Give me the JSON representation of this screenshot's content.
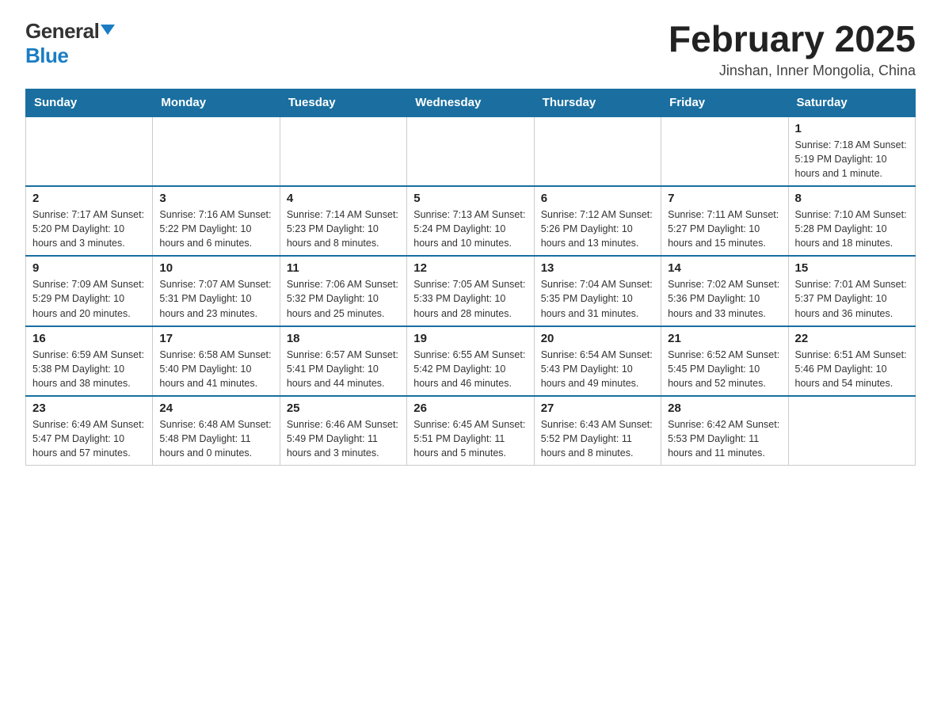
{
  "header": {
    "logo_general": "General",
    "logo_blue": "Blue",
    "month_title": "February 2025",
    "location": "Jinshan, Inner Mongolia, China"
  },
  "days_of_week": [
    "Sunday",
    "Monday",
    "Tuesday",
    "Wednesday",
    "Thursday",
    "Friday",
    "Saturday"
  ],
  "weeks": [
    [
      {
        "day": "",
        "info": ""
      },
      {
        "day": "",
        "info": ""
      },
      {
        "day": "",
        "info": ""
      },
      {
        "day": "",
        "info": ""
      },
      {
        "day": "",
        "info": ""
      },
      {
        "day": "",
        "info": ""
      },
      {
        "day": "1",
        "info": "Sunrise: 7:18 AM\nSunset: 5:19 PM\nDaylight: 10 hours and 1 minute."
      }
    ],
    [
      {
        "day": "2",
        "info": "Sunrise: 7:17 AM\nSunset: 5:20 PM\nDaylight: 10 hours and 3 minutes."
      },
      {
        "day": "3",
        "info": "Sunrise: 7:16 AM\nSunset: 5:22 PM\nDaylight: 10 hours and 6 minutes."
      },
      {
        "day": "4",
        "info": "Sunrise: 7:14 AM\nSunset: 5:23 PM\nDaylight: 10 hours and 8 minutes."
      },
      {
        "day": "5",
        "info": "Sunrise: 7:13 AM\nSunset: 5:24 PM\nDaylight: 10 hours and 10 minutes."
      },
      {
        "day": "6",
        "info": "Sunrise: 7:12 AM\nSunset: 5:26 PM\nDaylight: 10 hours and 13 minutes."
      },
      {
        "day": "7",
        "info": "Sunrise: 7:11 AM\nSunset: 5:27 PM\nDaylight: 10 hours and 15 minutes."
      },
      {
        "day": "8",
        "info": "Sunrise: 7:10 AM\nSunset: 5:28 PM\nDaylight: 10 hours and 18 minutes."
      }
    ],
    [
      {
        "day": "9",
        "info": "Sunrise: 7:09 AM\nSunset: 5:29 PM\nDaylight: 10 hours and 20 minutes."
      },
      {
        "day": "10",
        "info": "Sunrise: 7:07 AM\nSunset: 5:31 PM\nDaylight: 10 hours and 23 minutes."
      },
      {
        "day": "11",
        "info": "Sunrise: 7:06 AM\nSunset: 5:32 PM\nDaylight: 10 hours and 25 minutes."
      },
      {
        "day": "12",
        "info": "Sunrise: 7:05 AM\nSunset: 5:33 PM\nDaylight: 10 hours and 28 minutes."
      },
      {
        "day": "13",
        "info": "Sunrise: 7:04 AM\nSunset: 5:35 PM\nDaylight: 10 hours and 31 minutes."
      },
      {
        "day": "14",
        "info": "Sunrise: 7:02 AM\nSunset: 5:36 PM\nDaylight: 10 hours and 33 minutes."
      },
      {
        "day": "15",
        "info": "Sunrise: 7:01 AM\nSunset: 5:37 PM\nDaylight: 10 hours and 36 minutes."
      }
    ],
    [
      {
        "day": "16",
        "info": "Sunrise: 6:59 AM\nSunset: 5:38 PM\nDaylight: 10 hours and 38 minutes."
      },
      {
        "day": "17",
        "info": "Sunrise: 6:58 AM\nSunset: 5:40 PM\nDaylight: 10 hours and 41 minutes."
      },
      {
        "day": "18",
        "info": "Sunrise: 6:57 AM\nSunset: 5:41 PM\nDaylight: 10 hours and 44 minutes."
      },
      {
        "day": "19",
        "info": "Sunrise: 6:55 AM\nSunset: 5:42 PM\nDaylight: 10 hours and 46 minutes."
      },
      {
        "day": "20",
        "info": "Sunrise: 6:54 AM\nSunset: 5:43 PM\nDaylight: 10 hours and 49 minutes."
      },
      {
        "day": "21",
        "info": "Sunrise: 6:52 AM\nSunset: 5:45 PM\nDaylight: 10 hours and 52 minutes."
      },
      {
        "day": "22",
        "info": "Sunrise: 6:51 AM\nSunset: 5:46 PM\nDaylight: 10 hours and 54 minutes."
      }
    ],
    [
      {
        "day": "23",
        "info": "Sunrise: 6:49 AM\nSunset: 5:47 PM\nDaylight: 10 hours and 57 minutes."
      },
      {
        "day": "24",
        "info": "Sunrise: 6:48 AM\nSunset: 5:48 PM\nDaylight: 11 hours and 0 minutes."
      },
      {
        "day": "25",
        "info": "Sunrise: 6:46 AM\nSunset: 5:49 PM\nDaylight: 11 hours and 3 minutes."
      },
      {
        "day": "26",
        "info": "Sunrise: 6:45 AM\nSunset: 5:51 PM\nDaylight: 11 hours and 5 minutes."
      },
      {
        "day": "27",
        "info": "Sunrise: 6:43 AM\nSunset: 5:52 PM\nDaylight: 11 hours and 8 minutes."
      },
      {
        "day": "28",
        "info": "Sunrise: 6:42 AM\nSunset: 5:53 PM\nDaylight: 11 hours and 11 minutes."
      },
      {
        "day": "",
        "info": ""
      }
    ]
  ]
}
